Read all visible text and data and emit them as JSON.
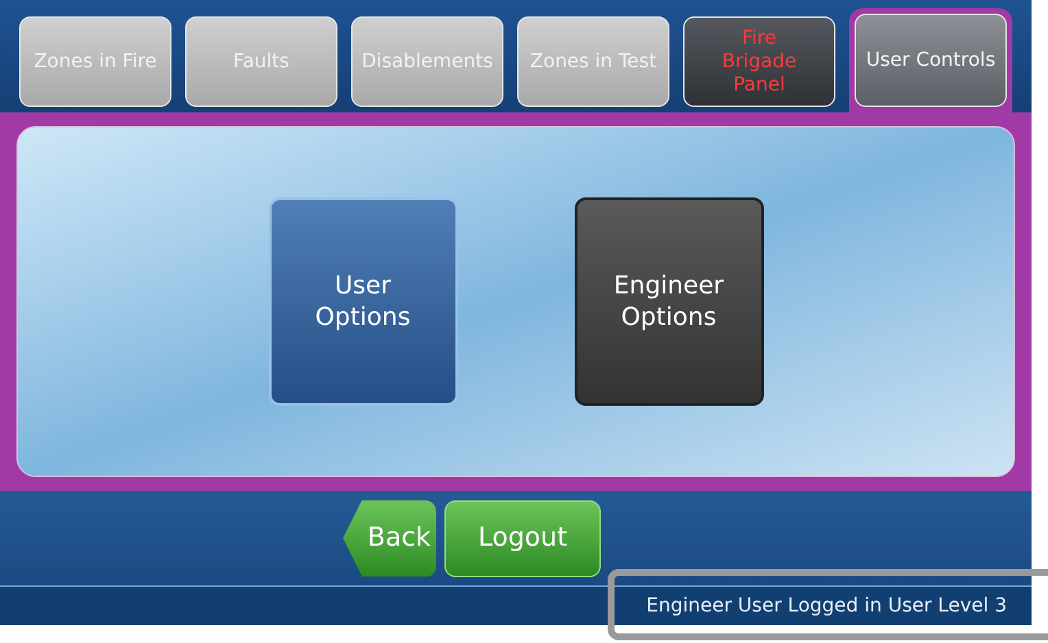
{
  "tabs": [
    {
      "label": "Zones in Fire",
      "kind": "plain",
      "selected": false
    },
    {
      "label": "Faults",
      "kind": "plain",
      "selected": false
    },
    {
      "label": "Disablements",
      "kind": "plain",
      "selected": false
    },
    {
      "label": "Zones in Test",
      "kind": "plain",
      "selected": false
    },
    {
      "label": "Fire Brigade Panel",
      "kind": "alert",
      "selected": false
    },
    {
      "label": "User Controls",
      "kind": "plain",
      "selected": true
    }
  ],
  "options": [
    {
      "label": "User Options",
      "kind": "user"
    },
    {
      "label": "Engineer Options",
      "kind": "engineer"
    }
  ],
  "nav_buttons": [
    {
      "label": "Back",
      "kind": "back"
    },
    {
      "label": "Logout",
      "kind": "plain"
    }
  ],
  "status_bar": "Engineer User Logged in User Level 3"
}
